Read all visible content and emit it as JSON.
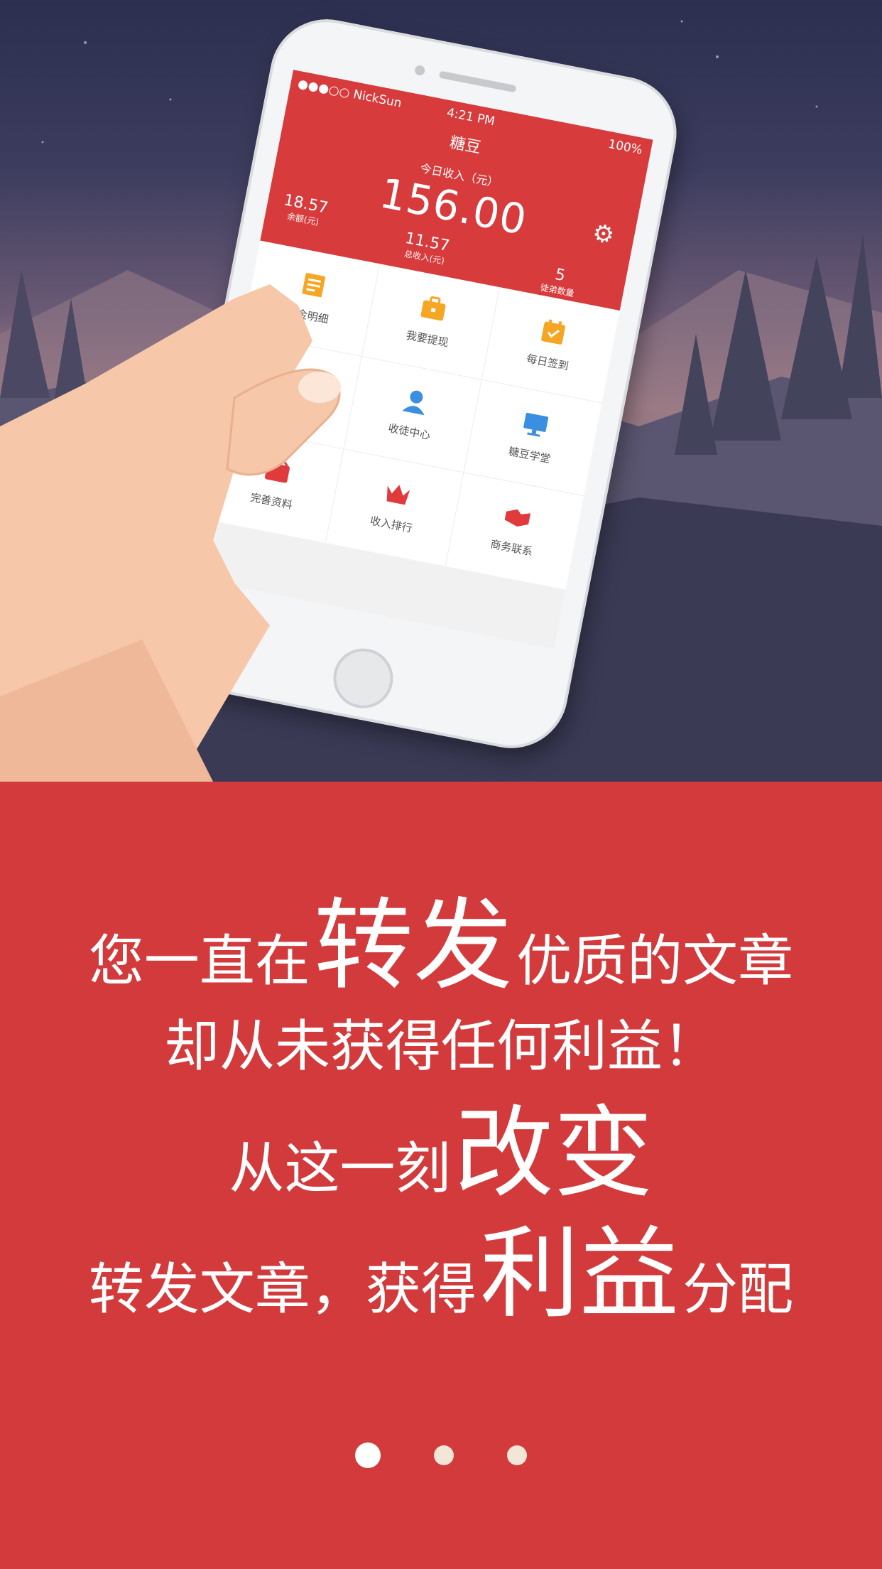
{
  "phone": {
    "status_carrier": "●●●○○ NickSun",
    "status_time": "4:21 PM",
    "status_battery": "100%",
    "app_title": "糖豆",
    "today_label": "今日收入（元）",
    "today_value": "156.00",
    "balance_value": "18.57",
    "balance_label": "余额(元)",
    "total_value": "11.57",
    "total_label": "总收入(元)",
    "disciples_value": "5",
    "disciples_label": "徒弟数量",
    "menu": [
      {
        "label": "资金明细",
        "icon": "ledger-icon",
        "color": "#f5a623"
      },
      {
        "label": "我要提现",
        "icon": "briefcase-icon",
        "color": "#f5a623"
      },
      {
        "label": "每日签到",
        "icon": "calendar-check-icon",
        "color": "#f5a623"
      },
      {
        "label": "",
        "icon": "",
        "color": ""
      },
      {
        "label": "收徒中心",
        "icon": "user-icon",
        "color": "#3a8fe0"
      },
      {
        "label": "糖豆学堂",
        "icon": "monitor-icon",
        "color": "#3a8fe0"
      },
      {
        "label": "完善资料",
        "icon": "profile-card-icon",
        "color": "#e03a3c"
      },
      {
        "label": "收入排行",
        "icon": "crown-icon",
        "color": "#e03a3c"
      },
      {
        "label": "商务联系",
        "icon": "handshake-icon",
        "color": "#e03a3c"
      }
    ]
  },
  "copy": {
    "l1_a": "您一直在",
    "l1_b": "转发",
    "l1_c": "优质的文章",
    "l2": "却从未获得任何利益！",
    "l3_a": "从这一刻",
    "l3_b": "改变",
    "l4_a": "转发文章，获得",
    "l4_b": "利益",
    "l4_c": "分配"
  },
  "pager": {
    "total": 3,
    "active": 1
  },
  "colors": {
    "brand_red": "#d33a3c",
    "accent_orange": "#f5a623",
    "accent_blue": "#3a8fe0"
  }
}
